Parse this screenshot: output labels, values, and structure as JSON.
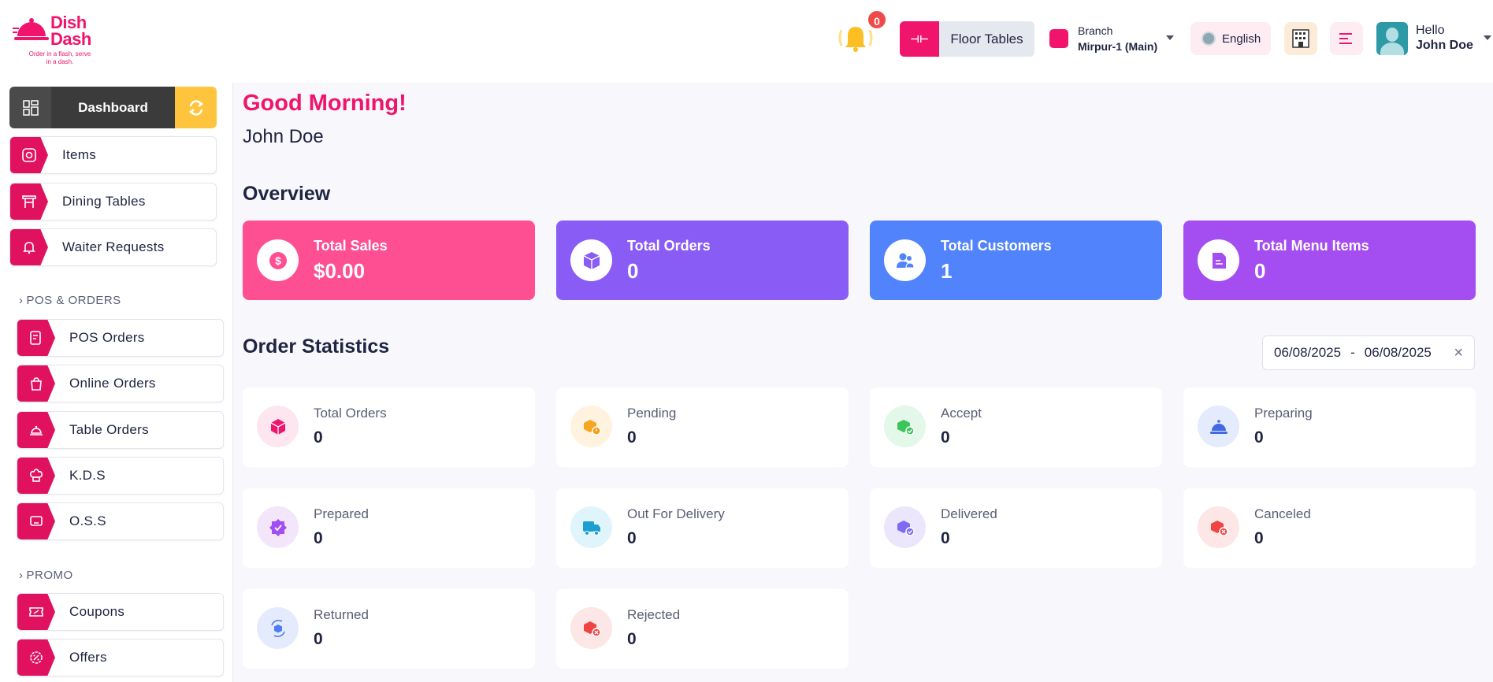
{
  "header": {
    "logo": {
      "name": "Dish Dash",
      "tagline": "Order in a flash, serve in a dash."
    },
    "notifications": {
      "count": "0"
    },
    "floor_tables": {
      "label": "Floor Tables",
      "icon_text": "⊣⊢"
    },
    "branch": {
      "label": "Branch",
      "value": "Mirpur-1 (Main)"
    },
    "language": {
      "label": "English"
    },
    "user": {
      "greeting": "Hello",
      "name": "John Doe"
    }
  },
  "sidebar": {
    "dashboard_label": "Dashboard",
    "top_items": [
      {
        "label": "Items"
      },
      {
        "label": "Dining Tables"
      },
      {
        "label": "Waiter Requests"
      }
    ],
    "sections": [
      {
        "title": "POS & ORDERS",
        "items": [
          {
            "label": "POS Orders"
          },
          {
            "label": "Online Orders"
          },
          {
            "label": "Table Orders"
          },
          {
            "label": "K.D.S"
          },
          {
            "label": "O.S.S"
          }
        ]
      },
      {
        "title": "PROMO",
        "items": [
          {
            "label": "Coupons"
          },
          {
            "label": "Offers"
          }
        ]
      }
    ]
  },
  "main": {
    "greeting": "Good Morning!",
    "user_name": "John Doe",
    "overview_title": "Overview",
    "overview": [
      {
        "label": "Total Sales",
        "value": "$0.00",
        "color": "#ff4f93"
      },
      {
        "label": "Total Orders",
        "value": "0",
        "color": "#8a5cf6"
      },
      {
        "label": "Total Customers",
        "value": "1",
        "color": "#5183fc"
      },
      {
        "label": "Total Menu Items",
        "value": "0",
        "color": "#a44ef1"
      }
    ],
    "order_statistics_title": "Order Statistics",
    "date_range": {
      "from": "06/08/2025",
      "separator": "-",
      "to": "06/08/2025"
    },
    "stats": [
      {
        "label": "Total Orders",
        "value": "0",
        "bg": "#fde6ef",
        "fg": "#f0146c"
      },
      {
        "label": "Pending",
        "value": "0",
        "bg": "#fff3e0",
        "fg": "#f5a623"
      },
      {
        "label": "Accept",
        "value": "0",
        "bg": "#e4f8e9",
        "fg": "#3cc35a"
      },
      {
        "label": "Preparing",
        "value": "0",
        "bg": "#e4ebfd",
        "fg": "#4169e1"
      },
      {
        "label": "Prepared",
        "value": "0",
        "bg": "#f3e6fb",
        "fg": "#a24ef1"
      },
      {
        "label": "Out For Delivery",
        "value": "0",
        "bg": "#e0f5fb",
        "fg": "#1a9fd0"
      },
      {
        "label": "Delivered",
        "value": "0",
        "bg": "#ebe6fb",
        "fg": "#7b6cf2"
      },
      {
        "label": "Canceled",
        "value": "0",
        "bg": "#fde6e6",
        "fg": "#ef4444"
      },
      {
        "label": "Returned",
        "value": "0",
        "bg": "#e4ebfd",
        "fg": "#4f7cf3"
      },
      {
        "label": "Rejected",
        "value": "0",
        "bg": "#fde6e6",
        "fg": "#ef4444"
      }
    ]
  }
}
